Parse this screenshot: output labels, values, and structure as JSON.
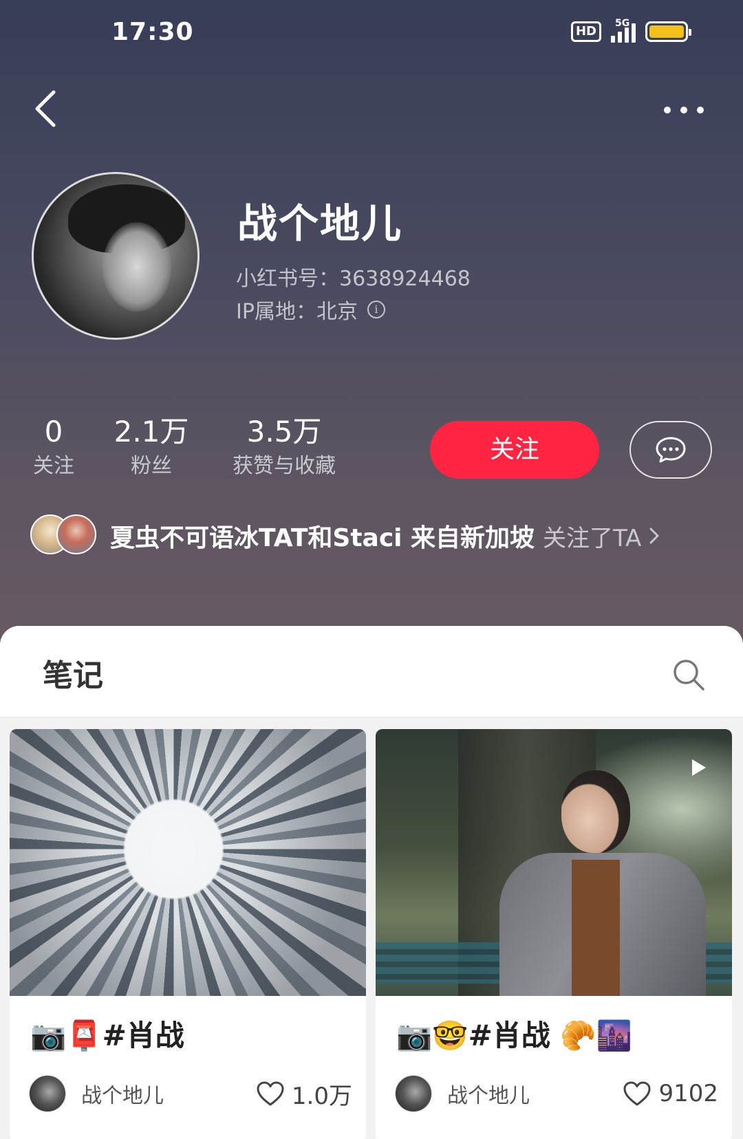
{
  "status_bar": {
    "time": "17:30",
    "hd": "HD",
    "network": "5G",
    "battery_color": "#f2c01a"
  },
  "profile": {
    "name": "战个地儿",
    "uid": "小红书号：3638924468",
    "ip": "IP属地：北京",
    "stats": [
      {
        "value": "0",
        "label": "关注"
      },
      {
        "value": "2.1万",
        "label": "粉丝"
      },
      {
        "value": "3.5万",
        "label": "获赞与收藏"
      }
    ],
    "follow_label": "关注",
    "accent_color": "#ff2442"
  },
  "mutual": {
    "names": "夏虫不可语冰TAT和Staci 来自新加坡",
    "suffix": "关注了TA"
  },
  "tabs": {
    "notes": "笔记"
  },
  "notes": [
    {
      "title": "📷📮#肖战",
      "author": "战个地儿",
      "likes": "1.0万",
      "has_video": false
    },
    {
      "title": "📷🤓#肖战 🥐🌆",
      "author": "战个地儿",
      "likes": "9102",
      "has_video": true
    }
  ],
  "icons": [
    "back-arrow-icon",
    "more-dots-icon",
    "info-icon",
    "message-icon",
    "chevron-right-icon",
    "search-icon",
    "heart-icon",
    "play-icon"
  ]
}
